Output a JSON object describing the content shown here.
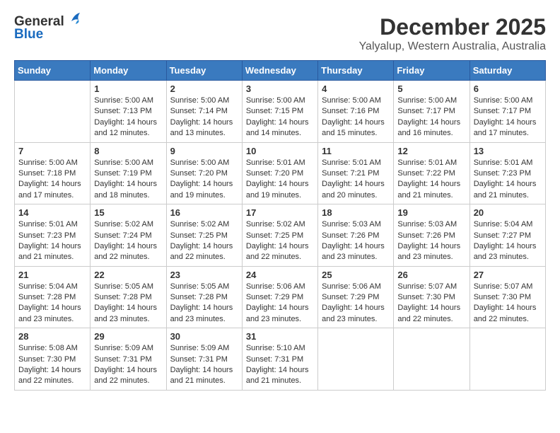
{
  "header": {
    "logo_line1": "General",
    "logo_line2": "Blue",
    "month": "December 2025",
    "location": "Yalyalup, Western Australia, Australia"
  },
  "weekdays": [
    "Sunday",
    "Monday",
    "Tuesday",
    "Wednesday",
    "Thursday",
    "Friday",
    "Saturday"
  ],
  "weeks": [
    [
      {
        "day": "",
        "sunrise": "",
        "sunset": "",
        "daylight": ""
      },
      {
        "day": "1",
        "sunrise": "Sunrise: 5:00 AM",
        "sunset": "Sunset: 7:13 PM",
        "daylight": "Daylight: 14 hours and 12 minutes."
      },
      {
        "day": "2",
        "sunrise": "Sunrise: 5:00 AM",
        "sunset": "Sunset: 7:14 PM",
        "daylight": "Daylight: 14 hours and 13 minutes."
      },
      {
        "day": "3",
        "sunrise": "Sunrise: 5:00 AM",
        "sunset": "Sunset: 7:15 PM",
        "daylight": "Daylight: 14 hours and 14 minutes."
      },
      {
        "day": "4",
        "sunrise": "Sunrise: 5:00 AM",
        "sunset": "Sunset: 7:16 PM",
        "daylight": "Daylight: 14 hours and 15 minutes."
      },
      {
        "day": "5",
        "sunrise": "Sunrise: 5:00 AM",
        "sunset": "Sunset: 7:17 PM",
        "daylight": "Daylight: 14 hours and 16 minutes."
      },
      {
        "day": "6",
        "sunrise": "Sunrise: 5:00 AM",
        "sunset": "Sunset: 7:17 PM",
        "daylight": "Daylight: 14 hours and 17 minutes."
      }
    ],
    [
      {
        "day": "7",
        "sunrise": "Sunrise: 5:00 AM",
        "sunset": "Sunset: 7:18 PM",
        "daylight": "Daylight: 14 hours and 17 minutes."
      },
      {
        "day": "8",
        "sunrise": "Sunrise: 5:00 AM",
        "sunset": "Sunset: 7:19 PM",
        "daylight": "Daylight: 14 hours and 18 minutes."
      },
      {
        "day": "9",
        "sunrise": "Sunrise: 5:00 AM",
        "sunset": "Sunset: 7:20 PM",
        "daylight": "Daylight: 14 hours and 19 minutes."
      },
      {
        "day": "10",
        "sunrise": "Sunrise: 5:01 AM",
        "sunset": "Sunset: 7:20 PM",
        "daylight": "Daylight: 14 hours and 19 minutes."
      },
      {
        "day": "11",
        "sunrise": "Sunrise: 5:01 AM",
        "sunset": "Sunset: 7:21 PM",
        "daylight": "Daylight: 14 hours and 20 minutes."
      },
      {
        "day": "12",
        "sunrise": "Sunrise: 5:01 AM",
        "sunset": "Sunset: 7:22 PM",
        "daylight": "Daylight: 14 hours and 21 minutes."
      },
      {
        "day": "13",
        "sunrise": "Sunrise: 5:01 AM",
        "sunset": "Sunset: 7:23 PM",
        "daylight": "Daylight: 14 hours and 21 minutes."
      }
    ],
    [
      {
        "day": "14",
        "sunrise": "Sunrise: 5:01 AM",
        "sunset": "Sunset: 7:23 PM",
        "daylight": "Daylight: 14 hours and 21 minutes."
      },
      {
        "day": "15",
        "sunrise": "Sunrise: 5:02 AM",
        "sunset": "Sunset: 7:24 PM",
        "daylight": "Daylight: 14 hours and 22 minutes."
      },
      {
        "day": "16",
        "sunrise": "Sunrise: 5:02 AM",
        "sunset": "Sunset: 7:25 PM",
        "daylight": "Daylight: 14 hours and 22 minutes."
      },
      {
        "day": "17",
        "sunrise": "Sunrise: 5:02 AM",
        "sunset": "Sunset: 7:25 PM",
        "daylight": "Daylight: 14 hours and 22 minutes."
      },
      {
        "day": "18",
        "sunrise": "Sunrise: 5:03 AM",
        "sunset": "Sunset: 7:26 PM",
        "daylight": "Daylight: 14 hours and 23 minutes."
      },
      {
        "day": "19",
        "sunrise": "Sunrise: 5:03 AM",
        "sunset": "Sunset: 7:26 PM",
        "daylight": "Daylight: 14 hours and 23 minutes."
      },
      {
        "day": "20",
        "sunrise": "Sunrise: 5:04 AM",
        "sunset": "Sunset: 7:27 PM",
        "daylight": "Daylight: 14 hours and 23 minutes."
      }
    ],
    [
      {
        "day": "21",
        "sunrise": "Sunrise: 5:04 AM",
        "sunset": "Sunset: 7:28 PM",
        "daylight": "Daylight: 14 hours and 23 minutes."
      },
      {
        "day": "22",
        "sunrise": "Sunrise: 5:05 AM",
        "sunset": "Sunset: 7:28 PM",
        "daylight": "Daylight: 14 hours and 23 minutes."
      },
      {
        "day": "23",
        "sunrise": "Sunrise: 5:05 AM",
        "sunset": "Sunset: 7:28 PM",
        "daylight": "Daylight: 14 hours and 23 minutes."
      },
      {
        "day": "24",
        "sunrise": "Sunrise: 5:06 AM",
        "sunset": "Sunset: 7:29 PM",
        "daylight": "Daylight: 14 hours and 23 minutes."
      },
      {
        "day": "25",
        "sunrise": "Sunrise: 5:06 AM",
        "sunset": "Sunset: 7:29 PM",
        "daylight": "Daylight: 14 hours and 23 minutes."
      },
      {
        "day": "26",
        "sunrise": "Sunrise: 5:07 AM",
        "sunset": "Sunset: 7:30 PM",
        "daylight": "Daylight: 14 hours and 22 minutes."
      },
      {
        "day": "27",
        "sunrise": "Sunrise: 5:07 AM",
        "sunset": "Sunset: 7:30 PM",
        "daylight": "Daylight: 14 hours and 22 minutes."
      }
    ],
    [
      {
        "day": "28",
        "sunrise": "Sunrise: 5:08 AM",
        "sunset": "Sunset: 7:30 PM",
        "daylight": "Daylight: 14 hours and 22 minutes."
      },
      {
        "day": "29",
        "sunrise": "Sunrise: 5:09 AM",
        "sunset": "Sunset: 7:31 PM",
        "daylight": "Daylight: 14 hours and 22 minutes."
      },
      {
        "day": "30",
        "sunrise": "Sunrise: 5:09 AM",
        "sunset": "Sunset: 7:31 PM",
        "daylight": "Daylight: 14 hours and 21 minutes."
      },
      {
        "day": "31",
        "sunrise": "Sunrise: 5:10 AM",
        "sunset": "Sunset: 7:31 PM",
        "daylight": "Daylight: 14 hours and 21 minutes."
      },
      {
        "day": "",
        "sunrise": "",
        "sunset": "",
        "daylight": ""
      },
      {
        "day": "",
        "sunrise": "",
        "sunset": "",
        "daylight": ""
      },
      {
        "day": "",
        "sunrise": "",
        "sunset": "",
        "daylight": ""
      }
    ]
  ]
}
